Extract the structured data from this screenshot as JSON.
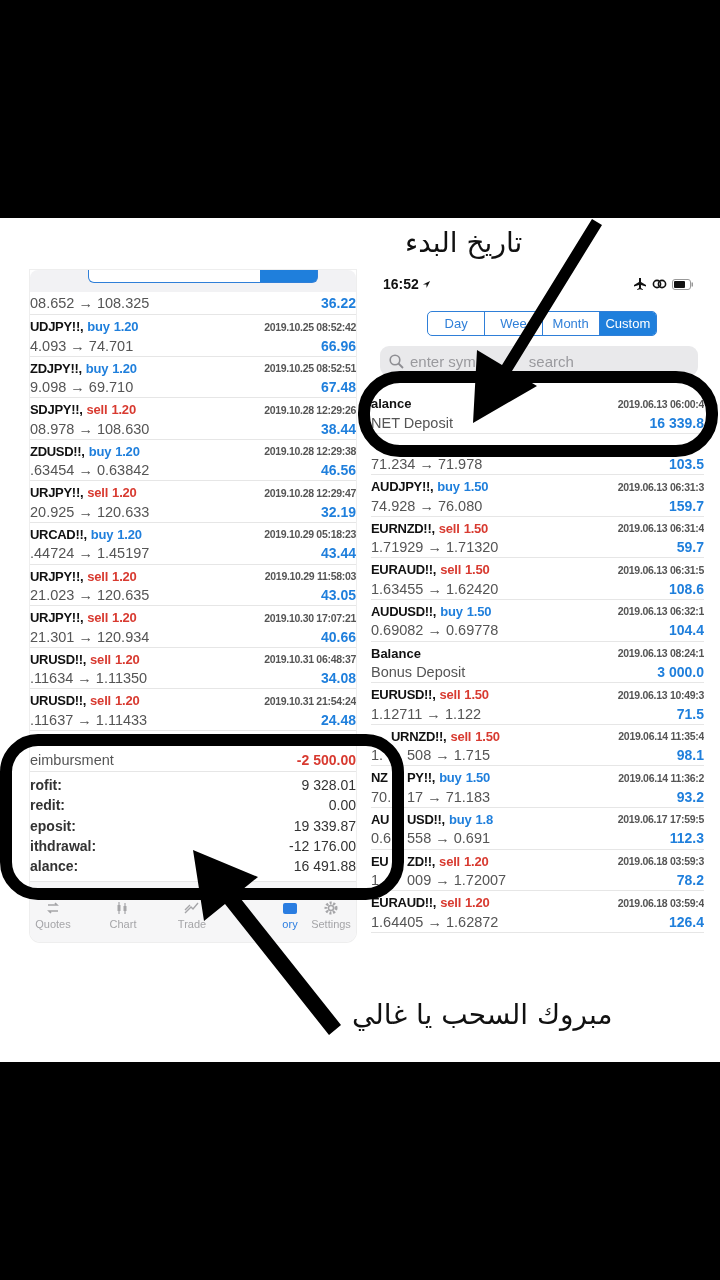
{
  "annotations": {
    "start_date_label": "تاريخ البدء",
    "withdrawal_label": "مبروك السحب يا غالي"
  },
  "left_screen": {
    "partial_row": {
      "prices": "08.652 → 108.325",
      "profit": "36.22"
    },
    "rows": [
      {
        "symbol": "UDJPY!!,",
        "side": "buy",
        "volume": "1.20",
        "time": "2019.10.25 08:52:42",
        "prices": "4.093 → 74.701",
        "profit": "66.96"
      },
      {
        "symbol": "ZDJPY!!,",
        "side": "buy",
        "volume": "1.20",
        "time": "2019.10.25 08:52:51",
        "prices": "9.098 → 69.710",
        "profit": "67.48"
      },
      {
        "symbol": "SDJPY!!,",
        "side": "sell",
        "volume": "1.20",
        "time": "2019.10.28 12:29:26",
        "prices": "08.978 → 108.630",
        "profit": "38.44"
      },
      {
        "symbol": "ZDUSD!!,",
        "side": "buy",
        "volume": "1.20",
        "time": "2019.10.28 12:29:38",
        "prices": ".63454 → 0.63842",
        "profit": "46.56"
      },
      {
        "symbol": "URJPY!!,",
        "side": "sell",
        "volume": "1.20",
        "time": "2019.10.28 12:29:47",
        "prices": "20.925 → 120.633",
        "profit": "32.19"
      },
      {
        "symbol": "URCAD!!,",
        "side": "buy",
        "volume": "1.20",
        "time": "2019.10.29 05:18:23",
        "prices": ".44724 → 1.45197",
        "profit": "43.44"
      },
      {
        "symbol": "URJPY!!,",
        "side": "sell",
        "volume": "1.20",
        "time": "2019.10.29 11:58:03",
        "prices": "21.023 → 120.635",
        "profit": "43.05"
      },
      {
        "symbol": "URJPY!!,",
        "side": "sell",
        "volume": "1.20",
        "time": "2019.10.30 17:07:21",
        "prices": "21.301 → 120.934",
        "profit": "40.66"
      },
      {
        "symbol": "URUSD!!,",
        "side": "sell",
        "volume": "1.20",
        "time": "2019.10.31 06:48:37",
        "prices": ".11634 → 1.11350",
        "profit": "34.08"
      },
      {
        "symbol": "URUSD!!,",
        "side": "sell",
        "volume": "1.20",
        "time": "2019.10.31 21:54:24",
        "prices": ".11637 → 1.11433",
        "profit": "24.48"
      }
    ],
    "balance_row": {
      "comment": "eimbursment",
      "amount": "-2 500.00",
      "negative": true
    },
    "summary": [
      {
        "label": "rofit:",
        "value": "9 328.01"
      },
      {
        "label": "redit:",
        "value": "0.00"
      },
      {
        "label": "eposit:",
        "value": "19 339.87"
      },
      {
        "label": "ithdrawal:",
        "value": "-12 176.00"
      },
      {
        "label": "alance:",
        "value": "16 491.88"
      }
    ],
    "tabs": [
      {
        "label": "Quotes",
        "selected": false
      },
      {
        "label": "Chart",
        "selected": false
      },
      {
        "label": "Trade",
        "selected": false
      },
      {
        "label": "ory",
        "selected": true
      },
      {
        "label": "Settings",
        "selected": false
      }
    ]
  },
  "right_screen": {
    "status_bar": {
      "time": "16:52"
    },
    "segments": [
      {
        "label": "Day",
        "selected": false
      },
      {
        "label": "Wee",
        "selected": false
      },
      {
        "label": "Month",
        "selected": false
      },
      {
        "label": "Custom",
        "selected": true
      }
    ],
    "search": {
      "placeholder_parts": [
        "enter sym",
        "search"
      ]
    },
    "rows": [
      {
        "kind": "balance",
        "title": "alance",
        "time": "2019.06.13 06:00:4",
        "comment": "NET Deposit",
        "amount": "16 339.8"
      },
      {
        "kind": "partial",
        "prices": [
          "71.234 → 71.978"
        ],
        "profit": "103.5"
      },
      {
        "kind": "trade",
        "symbol": [
          "AUDJPY!!,"
        ],
        "side": "buy",
        "volume": "1.50",
        "time": "2019.06.13 06:31:3",
        "prices": [
          "74.928 → 76.080"
        ],
        "profit": "159.7"
      },
      {
        "kind": "trade",
        "symbol": [
          "EURNZD!!,"
        ],
        "side": "sell",
        "volume": "1.50",
        "time": "2019.06.13 06:31:4",
        "prices": [
          "1.71929 → 1.71320"
        ],
        "profit": "59.7"
      },
      {
        "kind": "trade",
        "symbol": [
          "EURAUD!!,"
        ],
        "side": "sell",
        "volume": "1.50",
        "time": "2019.06.13 06:31:5",
        "prices": [
          "1.63455 → 1.62420"
        ],
        "profit": "108.6"
      },
      {
        "kind": "trade",
        "symbol": [
          "AUDUSD!!,"
        ],
        "side": "buy",
        "volume": "1.50",
        "time": "2019.06.13 06:32:1",
        "prices": [
          "0.69082 → 0.69778"
        ],
        "profit": "104.4"
      },
      {
        "kind": "balance",
        "title": "Balance",
        "time": "2019.06.13 08:24:1",
        "comment": "Bonus Deposit",
        "amount": "3 000.0"
      },
      {
        "kind": "trade",
        "symbol": [
          "EURUSD!!,"
        ],
        "side": "sell",
        "volume": "1.50",
        "time": "2019.06.13 10:49:3",
        "prices": [
          "1.12711 → 1.122"
        ],
        "profit": "71.5"
      },
      {
        "kind": "trade",
        "symbol": [
          "URNZD!!,"
        ],
        "side": "sell",
        "volume": "1.50",
        "time": "2019.06.14 11:35:4",
        "prices": [
          "1.",
          "508 → 1.715"
        ],
        "profit": "98.1"
      },
      {
        "kind": "trade",
        "symbol": [
          "NZ",
          "PY!!,"
        ],
        "side": "buy",
        "volume": "1.50",
        "time": "2019.06.14 11:36:2",
        "prices": [
          "70.",
          "17 → 71.183"
        ],
        "profit": "93.2"
      },
      {
        "kind": "trade",
        "symbol": [
          "AU",
          "USD!!,"
        ],
        "side": "buy",
        "volume": "1.8",
        "time": "2019.06.17 17:59:5",
        "prices": [
          "0.6",
          "558 → 0.691"
        ],
        "profit": "112.3"
      },
      {
        "kind": "trade",
        "symbol": [
          "EU",
          "ZD!!,"
        ],
        "side": "sell",
        "volume": "1.20",
        "time": "2019.06.18 03:59:3",
        "prices": [
          "1.",
          "009 → 1.72007"
        ],
        "profit": "78.2"
      },
      {
        "kind": "trade",
        "symbol": [
          "EURAUD!!,"
        ],
        "side": "sell",
        "volume": "1.20",
        "time": "2019.06.18 03:59:4",
        "prices": [
          "1.64405 → 1.62872"
        ],
        "profit": "126.4"
      }
    ]
  }
}
